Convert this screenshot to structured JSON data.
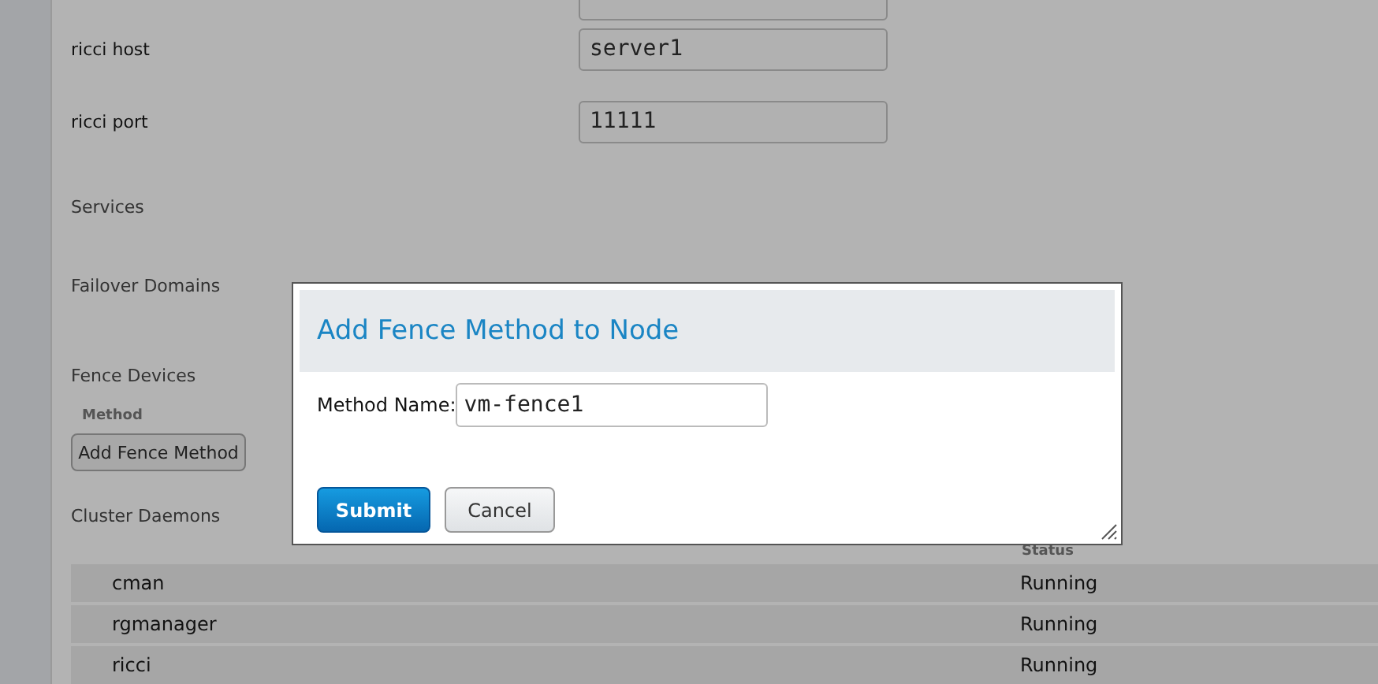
{
  "form": {
    "fields": [
      {
        "label": "ricci host",
        "value": "server1"
      },
      {
        "label": "ricci port",
        "value": "11111"
      }
    ]
  },
  "sections": {
    "services": "Services",
    "failover_domains": "Failover Domains",
    "fence_devices": "Fence Devices"
  },
  "fence": {
    "column": "Method",
    "button": "Add Fence Method"
  },
  "daemons": {
    "title": "Cluster Daemons",
    "status_header": "Status",
    "rows": [
      {
        "name": "cman",
        "status": "Running"
      },
      {
        "name": "rgmanager",
        "status": "Running"
      },
      {
        "name": "ricci",
        "status": "Running"
      }
    ]
  },
  "dialog": {
    "title": "Add Fence Method to Node",
    "field_label": "Method Name:",
    "field_value": "vm-fence1",
    "buttons": [
      {
        "label": "Submit",
        "kind": "primary"
      },
      {
        "label": "Cancel",
        "kind": "secondary"
      }
    ]
  }
}
